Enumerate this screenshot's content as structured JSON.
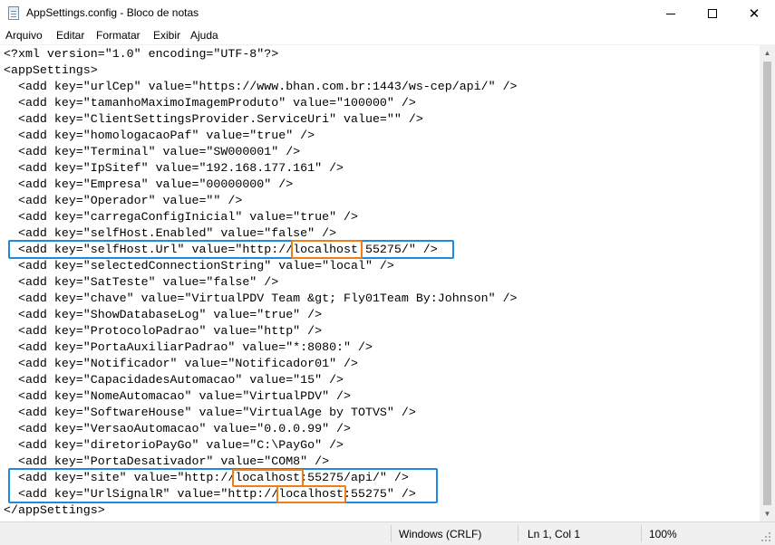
{
  "window": {
    "title": "AppSettings.config - Bloco de notas",
    "minimize_glyph": "",
    "close_glyph": "✕"
  },
  "menu": [
    "Arquivo",
    "Editar",
    "Formatar",
    "Exibir",
    "Ajuda"
  ],
  "content_lines": [
    "<?xml version=\"1.0\" encoding=\"UTF-8\"?>",
    "<appSettings>",
    "  <add key=\"urlCep\" value=\"https://www.bhan.com.br:1443/ws-cep/api/\" />",
    "  <add key=\"tamanhoMaximoImagemProduto\" value=\"100000\" />",
    "  <add key=\"ClientSettingsProvider.ServiceUri\" value=\"\" />",
    "  <add key=\"homologacaoPaf\" value=\"true\" />",
    "  <add key=\"Terminal\" value=\"SW000001\" />",
    "  <add key=\"IpSitef\" value=\"192.168.177.161\" />",
    "  <add key=\"Empresa\" value=\"00000000\" />",
    "  <add key=\"Operador\" value=\"\" />",
    "  <add key=\"carregaConfigInicial\" value=\"true\" />",
    "  <add key=\"selfHost.Enabled\" value=\"false\" />",
    "  <add key=\"selfHost.Url\" value=\"http://localhost:55275/\" />",
    "  <add key=\"selectedConnectionString\" value=\"local\" />",
    "  <add key=\"SatTeste\" value=\"false\" />",
    "  <add key=\"chave\" value=\"VirtualPDV Team &gt; Fly01Team By:Johnson\" />",
    "  <add key=\"ShowDatabaseLog\" value=\"true\" />",
    "  <add key=\"ProtocoloPadrao\" value=\"http\" />",
    "  <add key=\"PortaAuxiliarPadrao\" value=\"*:8080:\" />",
    "  <add key=\"Notificador\" value=\"Notificador01\" />",
    "  <add key=\"CapacidadesAutomacao\" value=\"15\" />",
    "  <add key=\"NomeAutomacao\" value=\"VirtualPDV\" />",
    "  <add key=\"SoftwareHouse\" value=\"VirtualAge by TOTVS\" />",
    "  <add key=\"VersaoAutomacao\" value=\"0.0.0.99\" />",
    "  <add key=\"diretorioPayGo\" value=\"C:\\PayGo\" />",
    "  <add key=\"PortaDesativador\" value=\"COM8\" />",
    "  <add key=\"site\" value=\"http://localhost:55275/api/\" />",
    "  <add key=\"UrlSignalR\" value=\"http://localhost:55275\" />",
    "</appSettings>"
  ],
  "status": {
    "line_ending": "Windows (CRLF)",
    "cursor": "Ln 1, Col 1",
    "zoom": "100%"
  },
  "colors": {
    "highlight_blue": "#1e88e5",
    "highlight_orange": "#ef7d18"
  }
}
